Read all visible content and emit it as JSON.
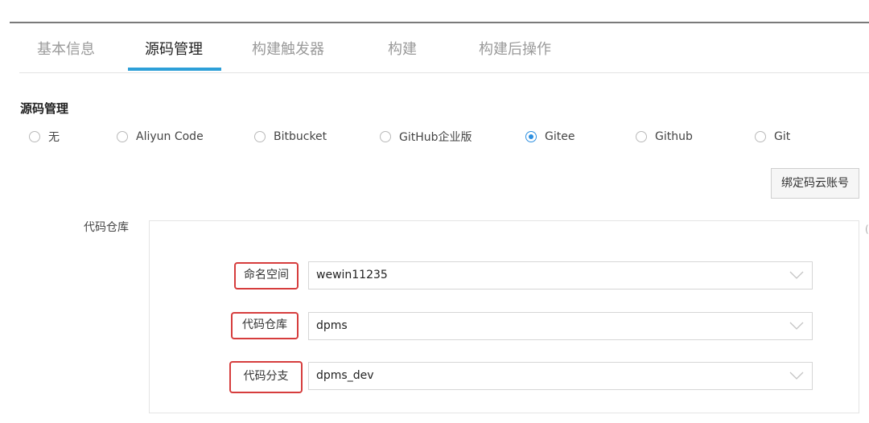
{
  "tabs": [
    {
      "label": "基本信息"
    },
    {
      "label": "源码管理"
    },
    {
      "label": "构建触发器"
    },
    {
      "label": "构建"
    },
    {
      "label": "构建后操作"
    }
  ],
  "active_tab": "源码管理",
  "source_control": {
    "title": "源码管理",
    "options": [
      {
        "label": "无"
      },
      {
        "label": "Aliyun Code"
      },
      {
        "label": "Bitbucket"
      },
      {
        "label": "GitHub企业版"
      },
      {
        "label": "Gitee"
      },
      {
        "label": "Github"
      },
      {
        "label": "Git"
      }
    ],
    "selected": "Gitee",
    "bind_button": "绑定码云账号"
  },
  "repository": {
    "label": "代码仓库",
    "fields": [
      {
        "label": "命名空间",
        "value": "wewin11235"
      },
      {
        "label": "代码仓库",
        "value": "dpms"
      },
      {
        "label": "代码分支",
        "value": "dpms_dev"
      }
    ]
  },
  "colors": {
    "accent": "#2d9fd8",
    "radio_checked": "#2d8fe0",
    "highlight_border": "#d63d3d"
  }
}
